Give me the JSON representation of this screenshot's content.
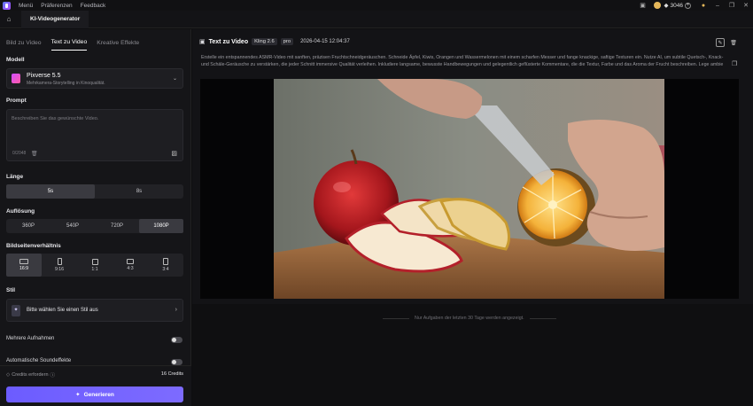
{
  "titlebar": {
    "menu": [
      "Menü",
      "Präferenzen",
      "Feedback"
    ],
    "credits": "3046"
  },
  "apptab": {
    "label": "KI-Videogenerator"
  },
  "sidebar": {
    "tabs": [
      "Bild zu Video",
      "Text zu Video",
      "Kreative Effekte"
    ],
    "model": {
      "section": "Modell",
      "name": "Pixverse 5.5",
      "sub": "Mehrkamera-Storytelling in Kinoqualität."
    },
    "prompt": {
      "section": "Prompt",
      "placeholder": "Beschreiben Sie das gewünschte Video.",
      "count": "0/2048"
    },
    "length": {
      "section": "Länge",
      "options": [
        "5s",
        "8s"
      ]
    },
    "resolution": {
      "section": "Auflösung",
      "options": [
        "360P",
        "540P",
        "720P",
        "1080P"
      ]
    },
    "ratio": {
      "section": "Bildseitenverhältnis",
      "options": [
        "16:9",
        "9:16",
        "1:1",
        "4:3",
        "3:4"
      ]
    },
    "style": {
      "section": "Stil",
      "label": "Bitte wählen Sie einen Stil aus"
    },
    "multi": "Mehrere Aufnahmen",
    "auto": "Automatische Soundeffekte",
    "credits_label": "Credits erfordern",
    "credits_value": "16 Credits",
    "generate": "Generieren"
  },
  "main": {
    "title": "Text zu Video",
    "chips": [
      "Kling 2.6",
      "pro"
    ],
    "timestamp": "2026-04-15 12:04:37",
    "prompt": "Erstelle ein entspannendes ASMR-Video mit sanften, präzisen Fruchtschneidgeräuschen. Schneide Äpfel, Kiwis, Orangen und Wassermelonen mit einem scharfen Messer und fange knackige, saftige Texturen ein. Nutze AI, um subtile Quetsch-, Knack- und Schäle-Geräusche zu verstärken, die jeder Schnitt immersive Qualität verleihen. Inkludiere langsame, bewusste Handbewegungen und gelegentlich geflüsterte Kommentare, die die Textur, Farbe und das Aroma der Frucht beschreiben. Lege ambie",
    "note": "Nur Aufgaben der letzten 30 Tage werden angezeigt."
  }
}
